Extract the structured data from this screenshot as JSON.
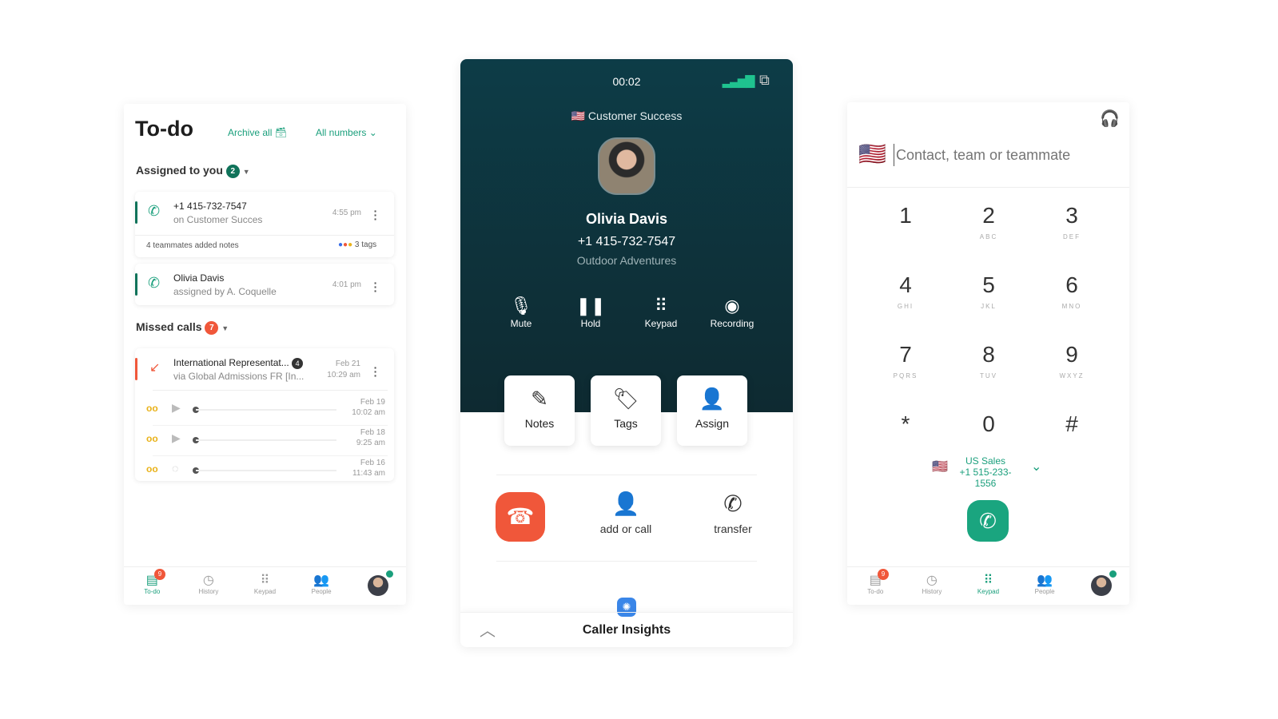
{
  "todo": {
    "title": "To-do",
    "archive_all": "Archive all",
    "all_numbers": "All numbers",
    "assigned": {
      "label": "Assigned to you",
      "count": "2"
    },
    "assigned_items": [
      {
        "title": "+1 415-732-7547",
        "subtitle": "on Customer Succes",
        "time": "4:55 pm",
        "notes": "4 teammates added notes",
        "tags": "3 tags"
      },
      {
        "title": "Olivia Davis",
        "subtitle": "assigned by A. Coquelle",
        "time": "4:01 pm"
      }
    ],
    "missed": {
      "label": "Missed calls",
      "count": "7"
    },
    "missed_item": {
      "title": "International Representat...",
      "count": "4",
      "subtitle": "via Global Admissions FR [In...",
      "date": "Feb 21",
      "time": "10:29 am"
    },
    "voicemails": [
      {
        "date": "Feb 19",
        "time": "10:02 am",
        "state": "play"
      },
      {
        "date": "Feb 18",
        "time": "9:25 am",
        "state": "play"
      },
      {
        "date": "Feb 16",
        "time": "11:43 am",
        "state": "loading"
      }
    ]
  },
  "nav": {
    "items": [
      "To-do",
      "History",
      "Keypad",
      "People"
    ],
    "todo_badge": "9"
  },
  "call": {
    "timer": "00:02",
    "line": "Customer Success",
    "name": "Olivia Davis",
    "number": "+1 415-732-7547",
    "company": "Outdoor Adventures",
    "controls": [
      "Mute",
      "Hold",
      "Keypad",
      "Recording"
    ],
    "tiles": [
      "Notes",
      "Tags",
      "Assign"
    ],
    "actions": [
      "add or call",
      "transfer"
    ],
    "insights": "Caller Insights"
  },
  "dialer": {
    "placeholder": "Contact, team or teammate",
    "keys": [
      {
        "n": "1",
        "l": ""
      },
      {
        "n": "2",
        "l": "ABC"
      },
      {
        "n": "3",
        "l": "DEF"
      },
      {
        "n": "4",
        "l": "GHI"
      },
      {
        "n": "5",
        "l": "JKL"
      },
      {
        "n": "6",
        "l": "MNO"
      },
      {
        "n": "7",
        "l": "PQRS"
      },
      {
        "n": "8",
        "l": "TUV"
      },
      {
        "n": "9",
        "l": "WXYZ"
      },
      {
        "n": "*",
        "l": ""
      },
      {
        "n": "0",
        "l": ""
      },
      {
        "n": "#",
        "l": ""
      }
    ],
    "line_name": "US Sales",
    "line_number": "+1 515-233-1556"
  },
  "colors": {
    "accent": "#1a9f7c",
    "dark": "#0d3c47",
    "missed": "#f0573a",
    "voicemail": "#e9b21a"
  }
}
